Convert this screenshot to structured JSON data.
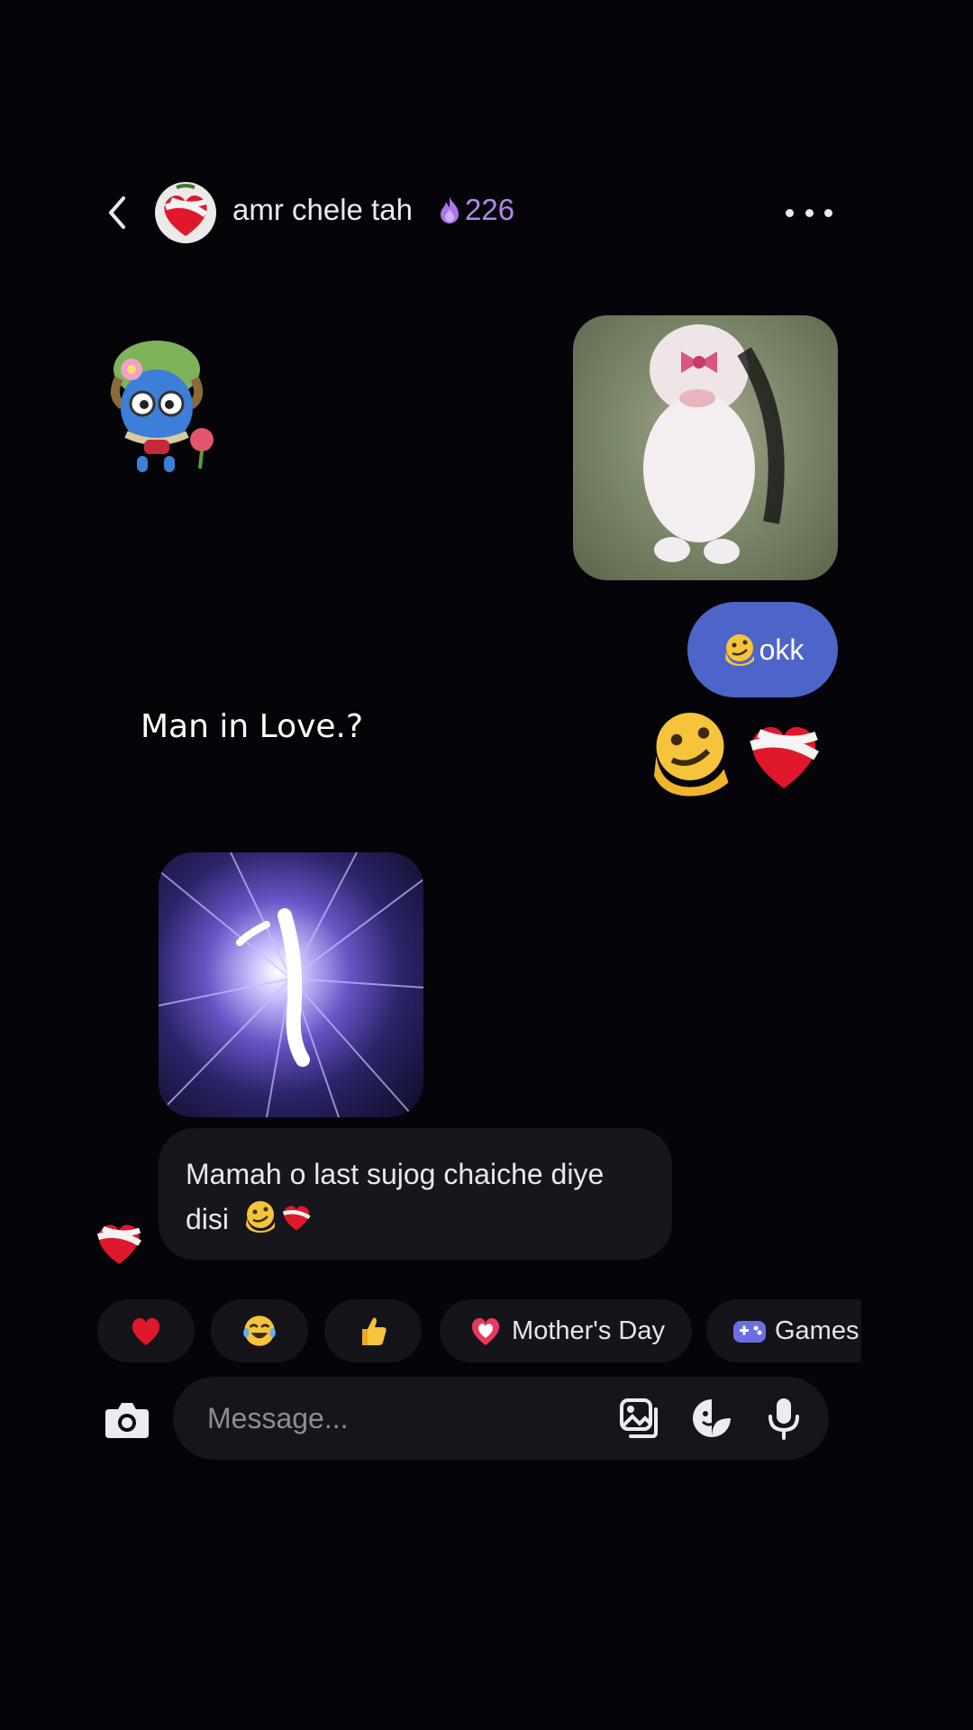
{
  "header": {
    "title": "amr chele tah",
    "streak_count": "226",
    "back_icon": "chevron-left-icon",
    "more_icon": "more-horizontal-icon"
  },
  "messages": {
    "sent_text": "okk",
    "caption": "Man in Love.?",
    "received_text": "Mamah o last sujog chaiche diye disi"
  },
  "quick_reactions": [
    {
      "icon": "red-heart-emoji",
      "label": ""
    },
    {
      "icon": "tears-of-joy-emoji",
      "label": ""
    },
    {
      "icon": "thumbs-up-emoji",
      "label": ""
    },
    {
      "icon": "heart-emoji",
      "label": "Mother's Day"
    },
    {
      "icon": "gamepad-icon",
      "label": "Games"
    }
  ],
  "composer": {
    "placeholder": "Message..."
  },
  "colors": {
    "background": "#050409",
    "sent_bubble": "#4d65c9",
    "received_bubble": "#17161d",
    "streak": "#b487e8"
  }
}
